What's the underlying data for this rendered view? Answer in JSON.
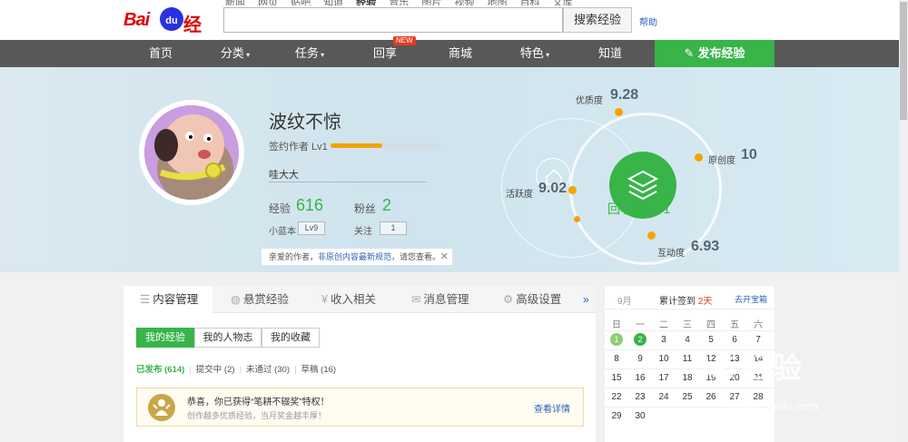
{
  "top_links": [
    "新闻",
    "网页",
    "贴吧",
    "知道",
    "经验",
    "音乐",
    "图片",
    "视频",
    "地图",
    "百科",
    "文库"
  ],
  "top_links_current": "经验",
  "logo": {
    "bai": "Bai",
    "du": "du",
    "jy": "经验"
  },
  "search": {
    "placeholder": "",
    "button": "搜索经验",
    "help": "帮助"
  },
  "nav": {
    "items": [
      "首页",
      "分类",
      "任务",
      "回享",
      "商城",
      "特色",
      "知道"
    ],
    "new_badge": "NEW",
    "publish": "发布经验"
  },
  "profile": {
    "name": "波纹不惊",
    "rank": "签约作者 Lv1",
    "level_progress": 0.47,
    "motto": "哇大大",
    "exp_label": "经验",
    "exp_value": "616",
    "fans_label": "粉丝",
    "fans_value": "2",
    "blue_label": "小蓝本",
    "blue_value": "Lv9",
    "follow_label": "关注",
    "follow_value": "1",
    "notice_prefix": "亲爱的作者，",
    "notice_link": "非原创内容最新规范",
    "notice_suffix": "，请您查看。",
    "notice_close": "✕"
  },
  "radar": {
    "quality_label": "优质度",
    "quality_value": "9.28",
    "original_label": "原创度",
    "original_value": "10",
    "activity_label": "活跃度",
    "activity_value": "9.02",
    "interaction_label": "互动度",
    "interaction_value": "6.93",
    "share_label": "回享度",
    "share_value": "3.51"
  },
  "tabs": [
    {
      "icon": "☰",
      "label": "内容管理"
    },
    {
      "icon": "◍",
      "label": "悬赏经验"
    },
    {
      "icon": "¥",
      "label": "收入相关"
    },
    {
      "icon": "✉",
      "label": "消息管理"
    },
    {
      "icon": "⚙",
      "label": "高级设置"
    }
  ],
  "tabs_more": "»",
  "subtabs": [
    "我的经验",
    "我的人物志",
    "我的收藏"
  ],
  "filters": {
    "published": "已发布 (614)",
    "submitting": "提交中 (2)",
    "rejected": "未通过 (30)",
    "draft": "草稿 (16)"
  },
  "award": {
    "line1": "恭喜，你已获得“笔耕不辍奖”特权！",
    "line2": "创作越多优质经验，当月奖金越丰厚！",
    "link": "查看详情"
  },
  "calendar": {
    "month": "9月",
    "streak_prefix": "累计签到 ",
    "streak_days": "2天",
    "open": "去开宝箱",
    "weekdays": [
      "日",
      "一",
      "二",
      "三",
      "四",
      "五",
      "六"
    ],
    "rows": [
      [
        "1",
        "2",
        "3",
        "4",
        "5",
        "6",
        "7"
      ],
      [
        "8",
        "9",
        "10",
        "11",
        "12",
        "13",
        "14"
      ],
      [
        "15",
        "16",
        "17",
        "18",
        "19",
        "20",
        "21"
      ],
      [
        "22",
        "23",
        "24",
        "25",
        "26",
        "27",
        "28"
      ],
      [
        "29",
        "30",
        "",
        "",
        "",
        "",
        ""
      ]
    ]
  },
  "watermark": {
    "main": "Bai 经验",
    "sub": "jingyan.baidu.com"
  }
}
